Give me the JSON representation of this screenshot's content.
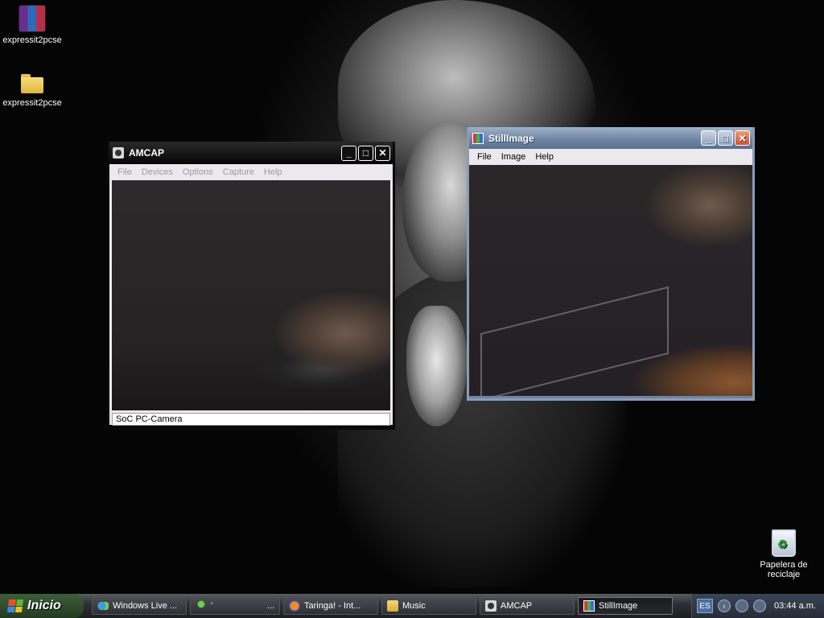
{
  "desktop": {
    "icons": [
      {
        "label": "expressit2pcse",
        "kind": "rar-icon"
      },
      {
        "label": "expressit2pcse",
        "kind": "folder-icon"
      },
      {
        "label": "Papelera de reciclaje",
        "kind": "recycle-bin-icon"
      }
    ]
  },
  "amcap": {
    "title": "AMCAP",
    "menus": [
      "File",
      "Devices",
      "Options",
      "Capture",
      "Help"
    ],
    "status": "SoC PC-Camera"
  },
  "still_image": {
    "title": "StillImage",
    "menus": [
      "File",
      "Image",
      "Help"
    ]
  },
  "title_buttons": {
    "minimize": "_",
    "maximize": "□",
    "close": "✕"
  },
  "taskbar": {
    "start_label": "Inicio",
    "tasks": [
      {
        "label": "Windows Live ...",
        "icon": "windows-live-icon"
      },
      {
        "label": "'",
        "icon": "messenger-icon"
      },
      {
        "label": "...",
        "icon": ""
      },
      {
        "label": "Taringa! - Int...",
        "icon": "firefox-icon"
      },
      {
        "label": "Music",
        "icon": "folder-icon"
      },
      {
        "label": "AMCAP",
        "icon": "camera-icon"
      },
      {
        "label": "StillImage",
        "icon": "stillimage-icon"
      }
    ],
    "tray": {
      "language": "ES",
      "clock": "03:44 a.m."
    }
  },
  "colors": {
    "xp_blue": "#6d83a3",
    "close_red": "#d4502a",
    "start_green": "#3d5e3a"
  }
}
